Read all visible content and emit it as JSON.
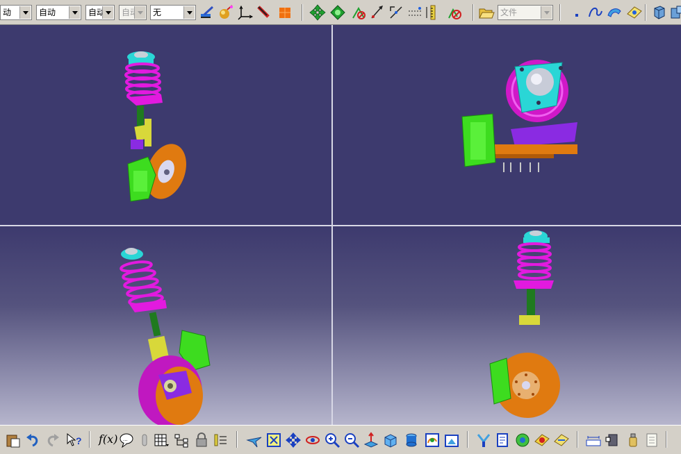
{
  "toolbar": {
    "combos": [
      {
        "value": "动",
        "enabled": true
      },
      {
        "value": "自动",
        "enabled": true
      },
      {
        "value": "自动",
        "enabled": true
      },
      {
        "value": "自动",
        "enabled": false
      },
      {
        "value": "无",
        "enabled": true
      },
      {
        "value": "文件",
        "enabled": false
      }
    ]
  },
  "bottom_toolbar": {
    "formula_label": "f(x)"
  },
  "viewports": [
    {
      "name": "top-left",
      "content": "strut-assembly-front-view"
    },
    {
      "name": "top-right",
      "content": "strut-assembly-top-view"
    },
    {
      "name": "bottom-left",
      "content": "strut-assembly-isometric-view"
    },
    {
      "name": "bottom-right",
      "content": "strut-assembly-side-view"
    }
  ],
  "colors": {
    "viewport_bg": "#3d3a6e",
    "spring": "#e21adf",
    "top_mount": "#2ad6d6",
    "damper": "#1f7a1f",
    "caliper": "#3ddc1f",
    "disc": "#e07a10",
    "knuckle": "#8a2be2",
    "bracket": "#d8d83a"
  }
}
